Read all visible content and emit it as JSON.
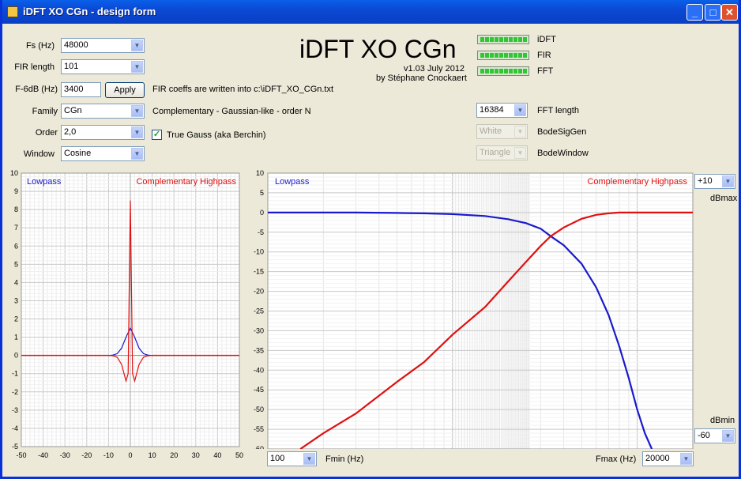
{
  "window": {
    "title": "iDFT XO CGn - design form",
    "icon": "app-icon"
  },
  "controls": {
    "fs": {
      "label": "Fs (Hz)",
      "value": "48000"
    },
    "fir_length": {
      "label": "FIR length",
      "value": "101"
    },
    "f6db": {
      "label": "F-6dB (Hz)",
      "value": "3400",
      "apply_label": "Apply",
      "note": "FIR coeffs are written into c:\\iDFT_XO_CGn.txt"
    },
    "family": {
      "label": "Family",
      "value": "CGn",
      "description": "Complementary - Gaussian-like - order N"
    },
    "order": {
      "label": "Order",
      "value": "2,0",
      "true_gauss_label": "True Gauss (aka Berchin)",
      "true_gauss_checked": true
    },
    "window": {
      "label": "Window",
      "value": "Cosine"
    }
  },
  "header": {
    "title": "iDFT XO CGn",
    "version": "v1.03 July 2012",
    "author": "by Stéphane Cnockaert"
  },
  "indicators": [
    {
      "label": "iDFT"
    },
    {
      "label": "FIR"
    },
    {
      "label": "FFT"
    }
  ],
  "fft": {
    "value": "16384",
    "label": "FFT length"
  },
  "bode_siggen": {
    "value": "White",
    "label": "BodeSigGen"
  },
  "bode_window": {
    "value": "Triangle",
    "label": "BodeWindow"
  },
  "impulse": {
    "lowpass_label": "Lowpass",
    "highpass_label": "Complementary Highpass"
  },
  "bode": {
    "lowpass_label": "Lowpass",
    "highpass_label": "Complementary Highpass",
    "dbmax_value": "+10",
    "dbmax_label": "dBmax",
    "dbmin_label": "dBmin",
    "dbmin_value": "-60",
    "fmin_value": "100",
    "fmin_label": "Fmin (Hz)",
    "fmax_label": "Fmax (Hz)",
    "fmax_value": "20000"
  },
  "colors": {
    "lowpass": "#1a1acc",
    "highpass": "#e01010"
  },
  "chart_data": [
    {
      "type": "line",
      "series": [
        {
          "name": "Lowpass",
          "x": [
            -10,
            -8,
            -6,
            -4,
            -2,
            0,
            2,
            4,
            6,
            8,
            10
          ],
          "values": [
            0,
            0.02,
            0.1,
            0.4,
            1.0,
            1.5,
            1.0,
            0.4,
            0.1,
            0.02,
            0
          ]
        },
        {
          "name": "Complementary Highpass",
          "x": [
            -10,
            -8,
            -6,
            -4,
            -2,
            -1,
            0,
            1,
            2,
            4,
            6,
            8,
            10
          ],
          "values": [
            0,
            -0.02,
            -0.1,
            -0.5,
            -1.4,
            -1.0,
            8.5,
            -1.0,
            -1.4,
            -0.5,
            -0.1,
            -0.02,
            0
          ]
        }
      ],
      "xlim": [
        -50,
        50
      ],
      "ylim": [
        -5,
        10
      ],
      "xticks": [
        -50,
        -40,
        -30,
        -20,
        -10,
        0,
        10,
        20,
        30,
        40,
        50
      ],
      "yticks": [
        10,
        9,
        8,
        7,
        6,
        5,
        4,
        3,
        2,
        1,
        0,
        -1,
        -2,
        -3,
        -4,
        -5
      ],
      "grid": true,
      "legend": "top"
    },
    {
      "type": "line",
      "series": [
        {
          "name": "Lowpass",
          "x": [
            100,
            300,
            500,
            700,
            1000,
            1500,
            2000,
            2500,
            3000,
            3400,
            4000,
            5000,
            6000,
            7000,
            8000,
            9000,
            10000,
            11000,
            12000
          ],
          "values": [
            0,
            0,
            -0.1,
            -0.2,
            -0.4,
            -0.9,
            -1.7,
            -2.7,
            -4.1,
            -6.0,
            -8.3,
            -13,
            -19,
            -26,
            -34,
            -42,
            -50,
            -56,
            -60
          ]
        },
        {
          "name": "Complementary Highpass",
          "x": [
            150,
            200,
            300,
            500,
            700,
            1000,
            1500,
            2000,
            2500,
            3000,
            3400,
            4000,
            5000,
            6000,
            7000,
            8000,
            9000,
            10000,
            20000
          ],
          "values": [
            -60,
            -56,
            -51,
            -43,
            -38,
            -31,
            -24,
            -17.5,
            -12.5,
            -8.5,
            -6.0,
            -3.8,
            -1.6,
            -0.6,
            -0.2,
            0,
            0,
            0,
            0
          ]
        }
      ],
      "xscale": "log",
      "xlim": [
        100,
        20000
      ],
      "ylim": [
        -60,
        10
      ],
      "yticks": [
        10,
        5,
        0,
        -5,
        -10,
        -15,
        -20,
        -25,
        -30,
        -35,
        -40,
        -45,
        -50,
        -55,
        -60
      ],
      "grid": true,
      "legend": "top"
    }
  ]
}
